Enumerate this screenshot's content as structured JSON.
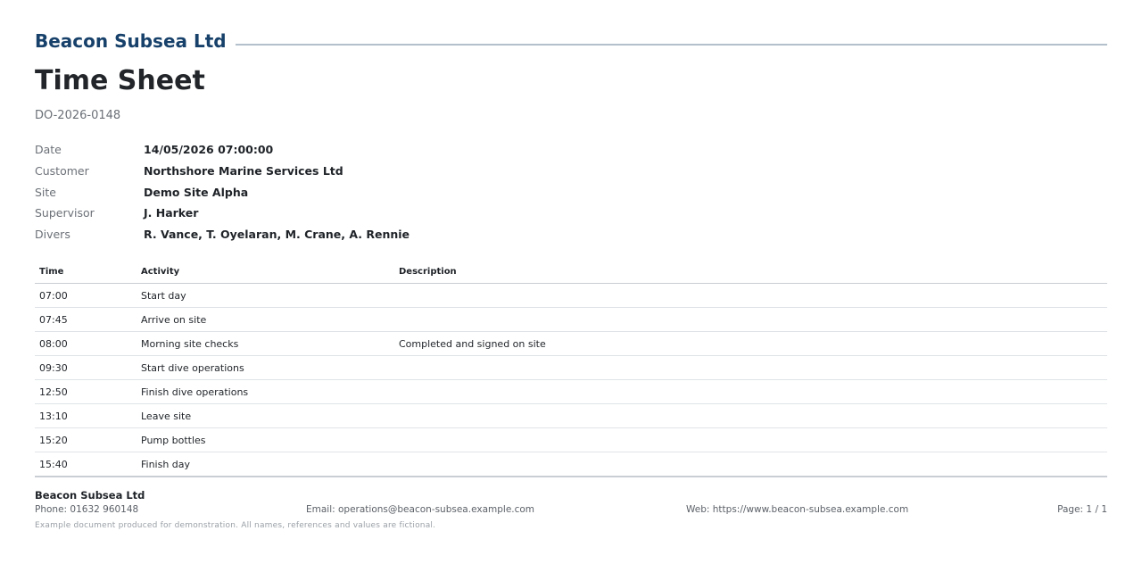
{
  "company": {
    "name": "Beacon Subsea Ltd"
  },
  "document": {
    "title": "Time Sheet",
    "reference": "DO-2026-0148"
  },
  "details": [
    {
      "label": "Date",
      "value": "14/05/2026 07:00:00"
    },
    {
      "label": "Customer",
      "value": "Northshore Marine Services Ltd"
    },
    {
      "label": "Site",
      "value": "Demo Site Alpha"
    },
    {
      "label": "Supervisor",
      "value": "J. Harker"
    },
    {
      "label": "Divers",
      "value": "R. Vance, T. Oyelaran, M. Crane, A. Rennie"
    }
  ],
  "table": {
    "headers": {
      "time": "Time",
      "activity": "Activity",
      "description": "Description"
    },
    "rows": [
      {
        "time": "07:00",
        "activity": "Start day",
        "description": ""
      },
      {
        "time": "07:45",
        "activity": "Arrive on site",
        "description": ""
      },
      {
        "time": "08:00",
        "activity": "Morning site checks",
        "description": "Completed and signed on site"
      },
      {
        "time": "09:30",
        "activity": "Start dive operations",
        "description": ""
      },
      {
        "time": "12:50",
        "activity": "Finish dive operations",
        "description": ""
      },
      {
        "time": "13:10",
        "activity": "Leave site",
        "description": ""
      },
      {
        "time": "15:20",
        "activity": "Pump bottles",
        "description": ""
      },
      {
        "time": "15:40",
        "activity": "Finish day",
        "description": ""
      }
    ]
  },
  "footer": {
    "company": "Beacon Subsea Ltd",
    "phone": "Phone: 01632 960148",
    "email": "Email: operations@beacon-subsea.example.com",
    "web": "Web: https://www.beacon-subsea.example.com",
    "page": "Page: 1 / 1",
    "note": "Example document produced for demonstration. All names, references and values are fictional."
  },
  "colors": {
    "brand": "#17416a",
    "rule": "#b4c0cb",
    "muted_text": "#6b7077"
  }
}
